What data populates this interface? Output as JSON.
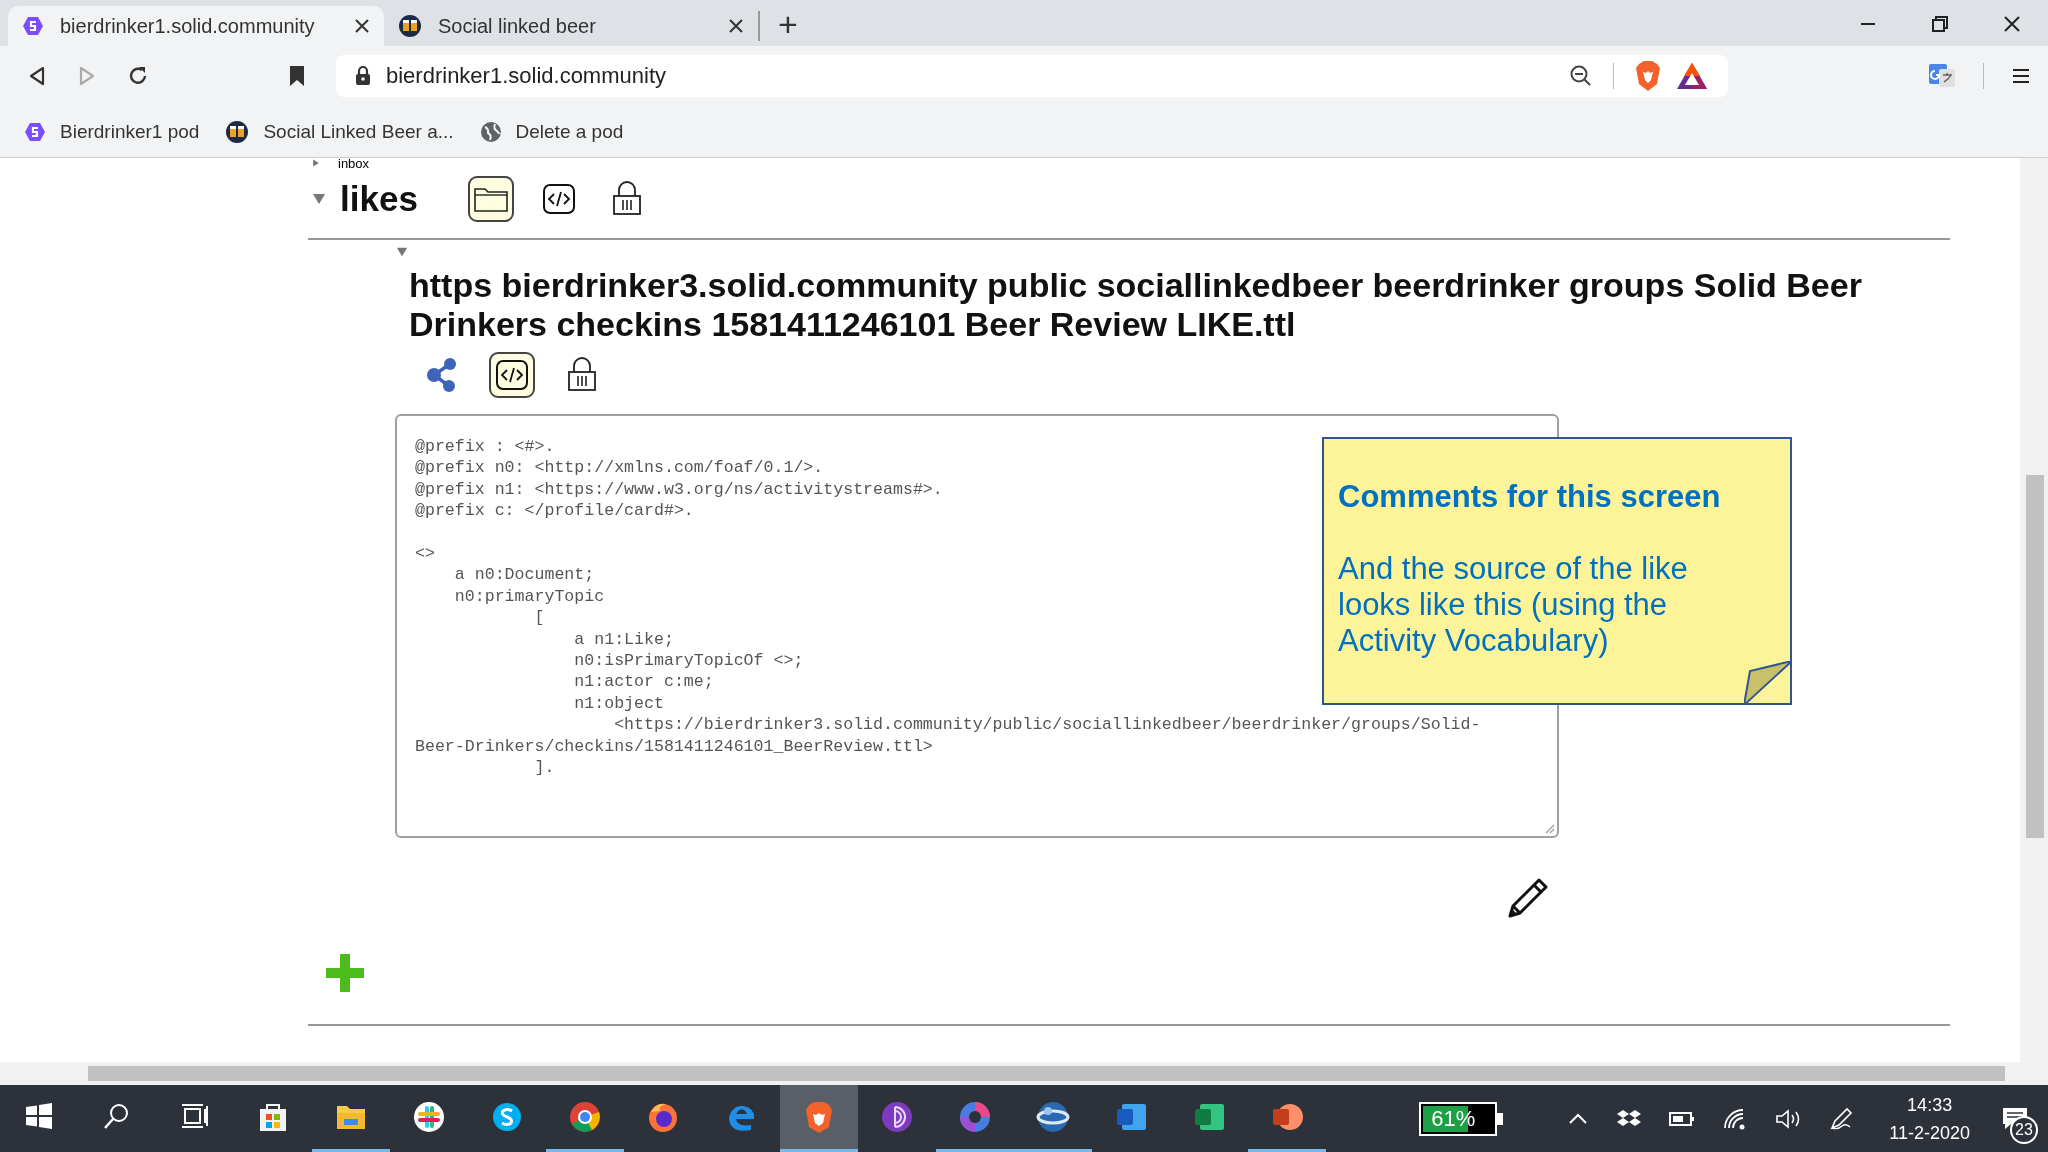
{
  "browser": {
    "tabs": [
      {
        "title": "bierdrinker1.solid.community",
        "kind": "solid",
        "selected": true
      },
      {
        "title": "Social linked beer",
        "kind": "beer",
        "selected": false
      }
    ],
    "new_tab": "+",
    "address": "bierdrinker1.solid.community",
    "bookmarks": [
      {
        "label": "Bierdrinker1 pod",
        "kind": "solid"
      },
      {
        "label": "Social Linked Beer a...",
        "kind": "beer"
      },
      {
        "label": "Delete a pod",
        "kind": "globe"
      }
    ]
  },
  "page": {
    "partial_item": "inbox",
    "folder": {
      "name": "likes",
      "expanded": true,
      "tools": [
        {
          "kind": "folder",
          "selected": true
        },
        {
          "kind": "source",
          "selected": false
        },
        {
          "kind": "lock",
          "selected": false
        }
      ]
    },
    "file": {
      "expanded": true,
      "title": "https bierdrinker3.solid.community public sociallinkedbeer beerdrinker groups Solid Beer Drinkers checkins 1581411246101 Beer Review LIKE.ttl",
      "tools": [
        {
          "kind": "share",
          "selected": false
        },
        {
          "kind": "source",
          "selected": true
        },
        {
          "kind": "lock",
          "selected": false
        }
      ],
      "source": "@prefix : <#>.\n@prefix n0: <http://xmlns.com/foaf/0.1/>.\n@prefix n1: <https://www.w3.org/ns/activitystreams#>.\n@prefix c: </profile/card#>.\n\n<>\n    a n0:Document;\n    n0:primaryTopic\n            [\n                a n1:Like;\n                n0:isPrimaryTopicOf <>;\n                n1:actor c:me;\n                n1:object\n                    <https://bierdrinker3.solid.community/public/sociallinkedbeer/beerdrinker/groups/Solid-\nBeer-Drinkers/checkins/1581411246101_BeerReview.ttl>\n            ]."
    }
  },
  "note": {
    "title": "Comments for this screen",
    "body": "And the source of the like looks like this (using the Activity Vocabulary)"
  },
  "taskbar": {
    "apps": [
      {
        "kind": "start",
        "running": false,
        "selected": false
      },
      {
        "kind": "search",
        "running": false,
        "selected": false
      },
      {
        "kind": "taskview",
        "running": false,
        "selected": false
      },
      {
        "kind": "store",
        "running": false,
        "selected": false
      },
      {
        "kind": "explorer",
        "running": true,
        "selected": false
      },
      {
        "kind": "slack",
        "running": false,
        "selected": false
      },
      {
        "kind": "skype",
        "running": false,
        "selected": false
      },
      {
        "kind": "chrome",
        "running": true,
        "selected": false
      },
      {
        "kind": "firefox",
        "running": false,
        "selected": false
      },
      {
        "kind": "edge",
        "running": false,
        "selected": false
      },
      {
        "kind": "brave",
        "running": true,
        "selected": true
      },
      {
        "kind": "tor",
        "running": false,
        "selected": false
      },
      {
        "kind": "swirl",
        "running": true,
        "selected": false
      },
      {
        "kind": "globe",
        "running": true,
        "selected": false
      },
      {
        "kind": "word",
        "running": false,
        "selected": false
      },
      {
        "kind": "excel",
        "running": false,
        "selected": false
      },
      {
        "kind": "powerpoint",
        "running": true,
        "selected": false
      }
    ],
    "battery": "61%",
    "time": "14:33",
    "date": "11-2-2020",
    "notifications": "23"
  }
}
